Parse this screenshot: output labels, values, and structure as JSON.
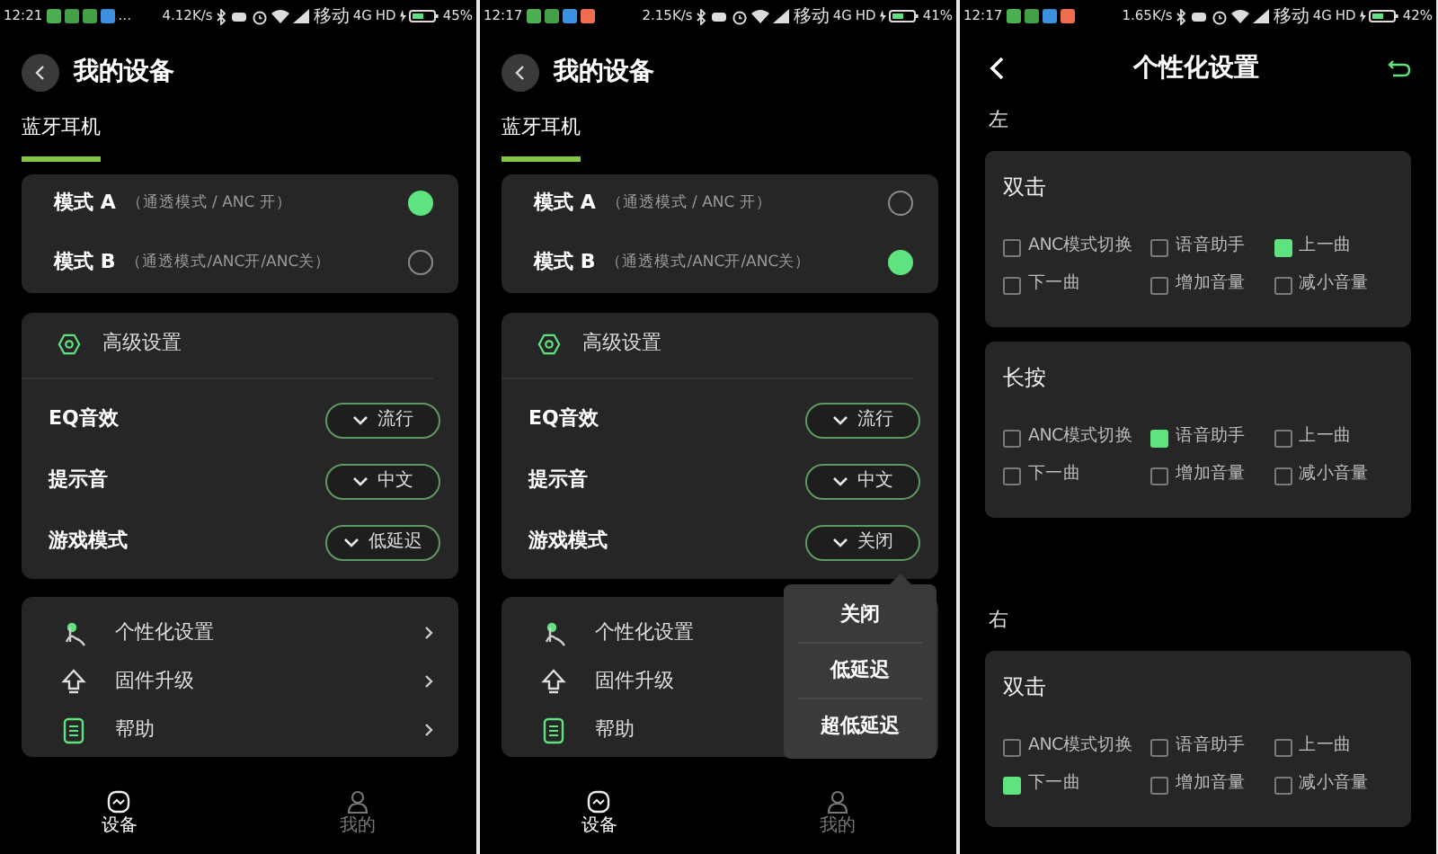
{
  "screens": [
    {
      "kind": "device",
      "status_bar": {
        "time": "12:21",
        "notifications": [
          {
            "color": "#4caf50"
          },
          {
            "color": "#43a047"
          },
          {
            "color": "#43a047"
          },
          {
            "color": "#3d8fe0"
          }
        ],
        "overflow": "…",
        "speed": "4.12K/s",
        "carrier": "移动",
        "network": "4G",
        "hd": "HD",
        "battery": "45%"
      },
      "header": {
        "title": "我的设备"
      },
      "tab": {
        "label": "蓝牙耳机",
        "selected": true
      },
      "modes": [
        {
          "name": "模式 A",
          "desc": "（通透模式 / ANC 开）",
          "selected": true
        },
        {
          "name": "模式 B",
          "desc": "（通透模式/ANC开/ANC关）",
          "selected": false
        }
      ],
      "advanced": {
        "title": "高级设置",
        "settings": [
          {
            "label": "EQ音效",
            "value": "流行"
          },
          {
            "label": "提示音",
            "value": "中文"
          },
          {
            "label": "游戏模式",
            "value": "低延迟"
          }
        ]
      },
      "menu": [
        {
          "label": "个性化设置",
          "chevron": true
        },
        {
          "label": "固件升级",
          "chevron": true
        },
        {
          "label": "帮助",
          "chevron": true
        }
      ],
      "bottom_nav": [
        {
          "label": "设备",
          "selected": true
        },
        {
          "label": "我的",
          "selected": false
        }
      ]
    },
    {
      "kind": "device",
      "status_bar": {
        "time": "12:17",
        "notifications": [
          {
            "color": "#4caf50"
          },
          {
            "color": "#43a047"
          },
          {
            "color": "#3d8fe0"
          },
          {
            "color": "#f06c4f"
          }
        ],
        "speed": "2.15K/s",
        "carrier": "移动",
        "network": "4G",
        "hd": "HD",
        "battery": "41%"
      },
      "header": {
        "title": "我的设备"
      },
      "tab": {
        "label": "蓝牙耳机",
        "selected": true
      },
      "modes": [
        {
          "name": "模式 A",
          "desc": "（通透模式 / ANC 开）",
          "selected": false
        },
        {
          "name": "模式 B",
          "desc": "（通透模式/ANC开/ANC关）",
          "selected": true
        }
      ],
      "advanced": {
        "title": "高级设置",
        "settings": [
          {
            "label": "EQ音效",
            "value": "流行"
          },
          {
            "label": "提示音",
            "value": "中文"
          },
          {
            "label": "游戏模式",
            "value": "关闭"
          }
        ]
      },
      "menu": [
        {
          "label": "个性化设置",
          "chevron": false
        },
        {
          "label": "固件升级",
          "chevron": false
        },
        {
          "label": "帮助",
          "chevron": false
        }
      ],
      "dropdown": {
        "options": [
          "关闭",
          "低延迟",
          "超低延迟"
        ]
      },
      "bottom_nav": [
        {
          "label": "设备",
          "selected": true
        },
        {
          "label": "我的",
          "selected": false
        }
      ]
    },
    {
      "kind": "personalize",
      "status_bar": {
        "time": "12:17",
        "notifications": [
          {
            "color": "#4caf50"
          },
          {
            "color": "#43a047"
          },
          {
            "color": "#3d8fe0"
          },
          {
            "color": "#f06c4f"
          }
        ],
        "speed": "1.65K/s",
        "carrier": "移动",
        "network": "4G",
        "hd": "HD",
        "battery": "42%"
      },
      "header": {
        "title": "个性化设置"
      },
      "sections": [
        {
          "side": "左",
          "groups": [
            {
              "title": "双击",
              "options": [
                {
                  "label": "ANC模式切换",
                  "checked": false
                },
                {
                  "label": "语音助手",
                  "checked": false
                },
                {
                  "label": "上一曲",
                  "checked": true
                },
                {
                  "label": "下一曲",
                  "checked": false
                },
                {
                  "label": "增加音量",
                  "checked": false
                },
                {
                  "label": "减小音量",
                  "checked": false
                }
              ]
            },
            {
              "title": "长按",
              "options": [
                {
                  "label": "ANC模式切换",
                  "checked": false
                },
                {
                  "label": "语音助手",
                  "checked": true
                },
                {
                  "label": "上一曲",
                  "checked": false
                },
                {
                  "label": "下一曲",
                  "checked": false
                },
                {
                  "label": "增加音量",
                  "checked": false
                },
                {
                  "label": "减小音量",
                  "checked": false
                }
              ]
            }
          ]
        },
        {
          "side": "右",
          "groups": [
            {
              "title": "双击",
              "options": [
                {
                  "label": "ANC模式切换",
                  "checked": false
                },
                {
                  "label": "语音助手",
                  "checked": false
                },
                {
                  "label": "上一曲",
                  "checked": false
                },
                {
                  "label": "下一曲",
                  "checked": true
                },
                {
                  "label": "增加音量",
                  "checked": false
                },
                {
                  "label": "减小音量",
                  "checked": false
                }
              ]
            }
          ]
        }
      ]
    }
  ]
}
